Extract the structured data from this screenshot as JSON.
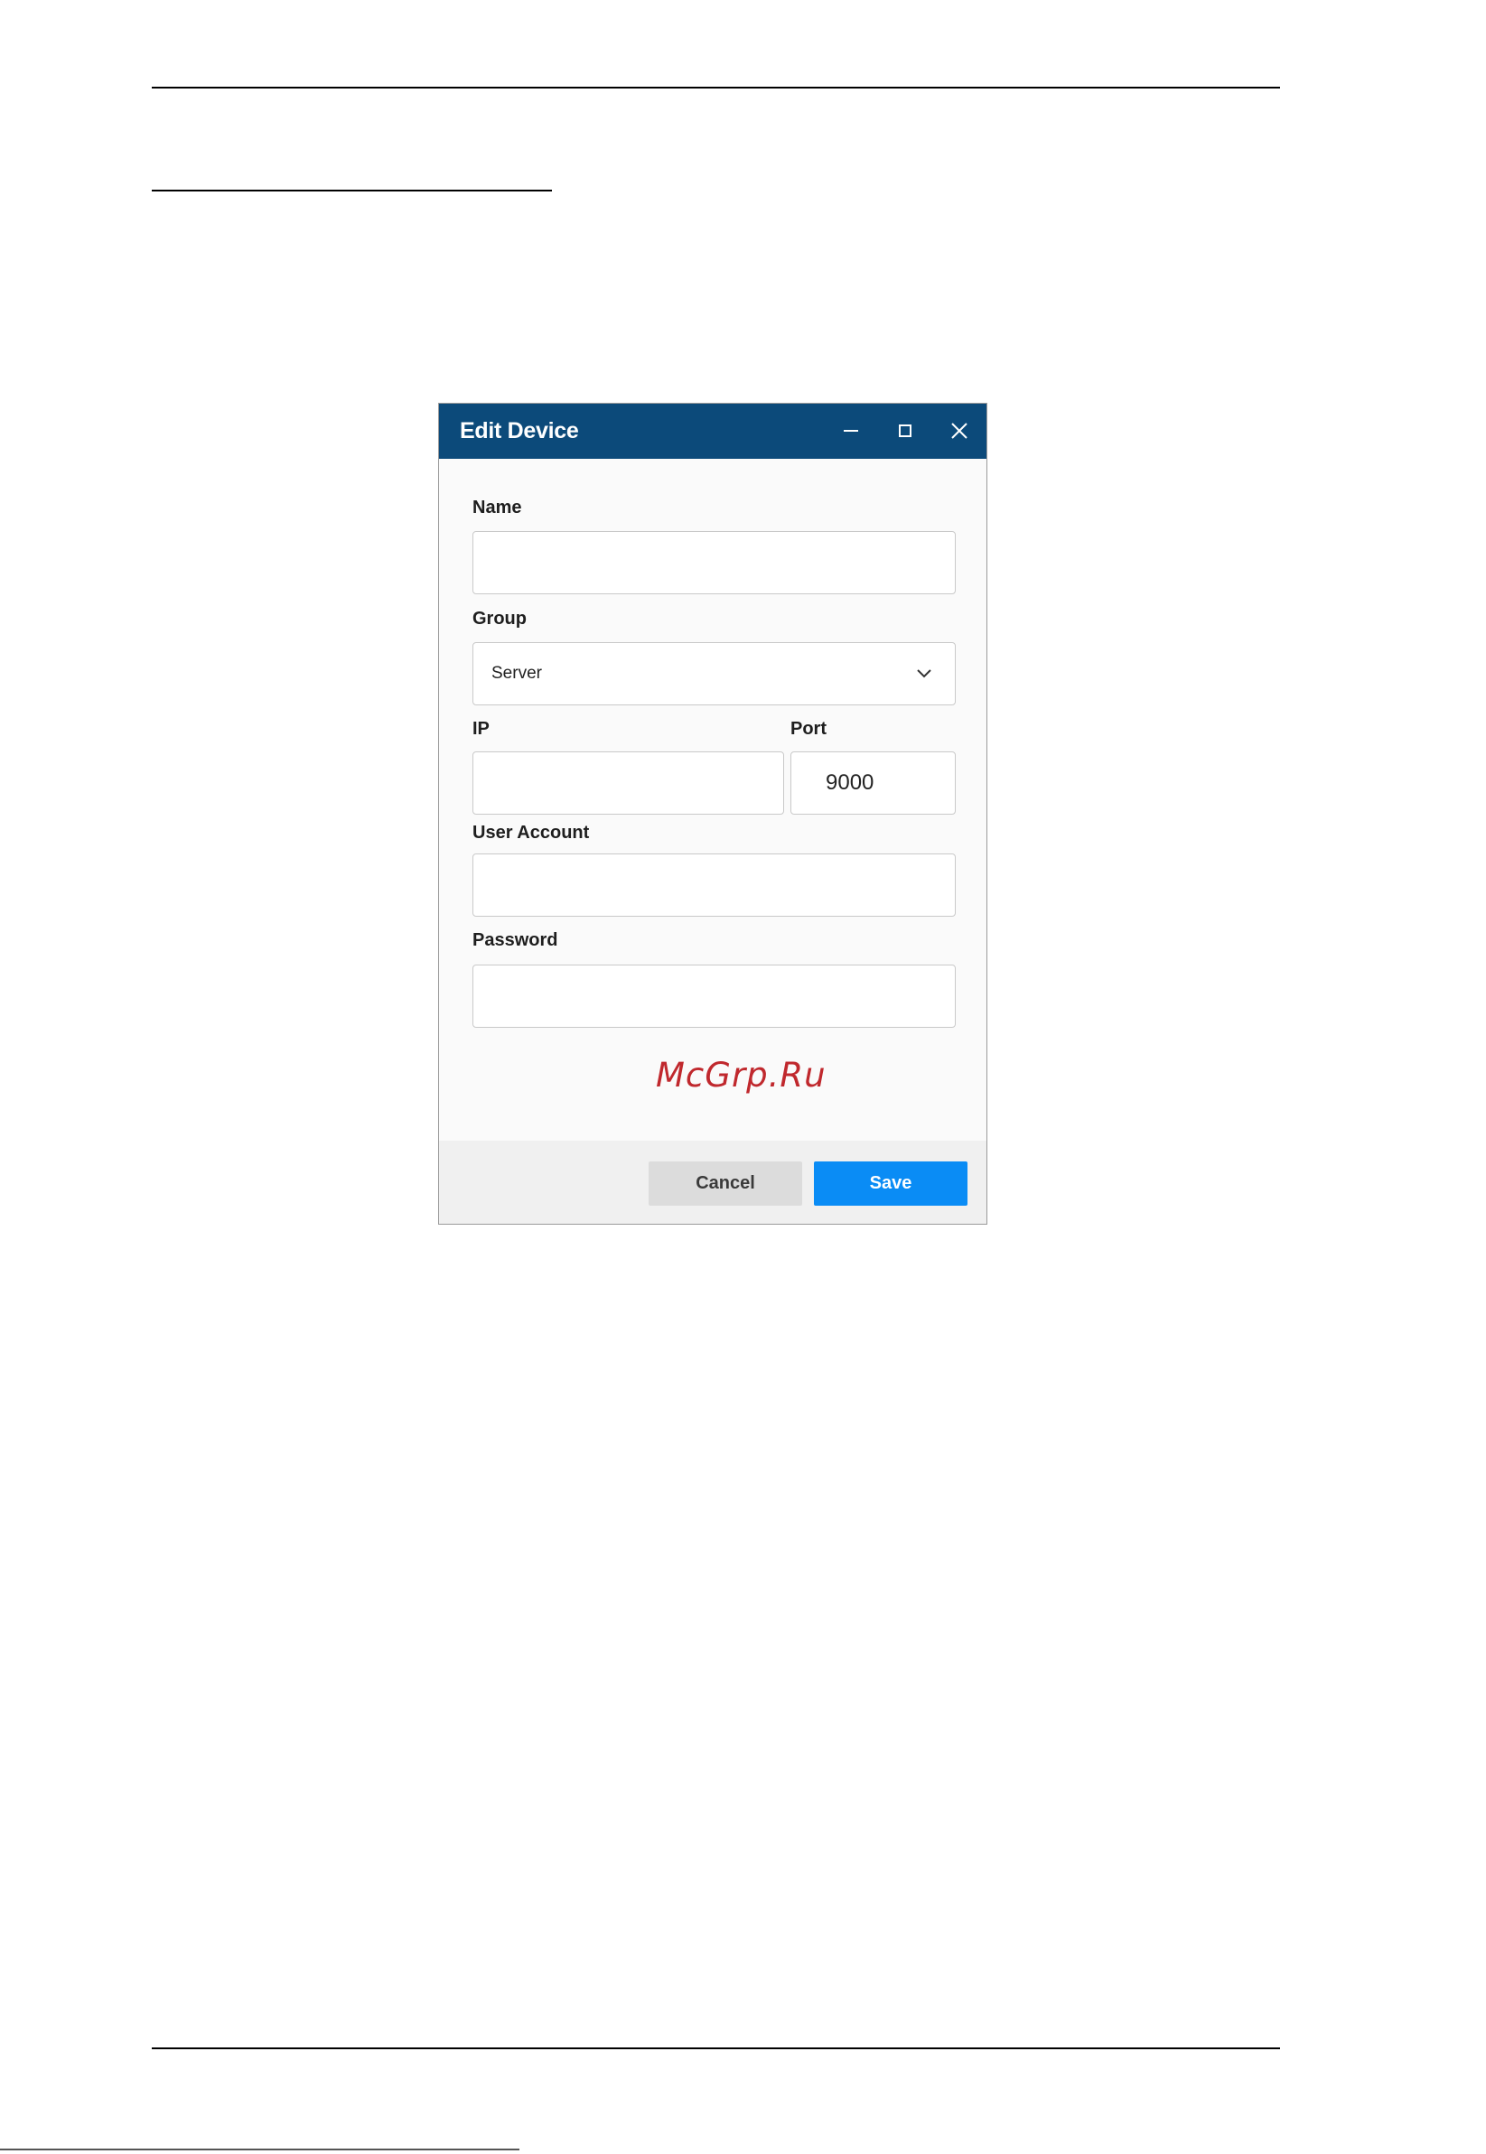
{
  "dialog": {
    "title": "Edit Device",
    "controls": {
      "minimize_icon": "minimize-icon",
      "maximize_icon": "maximize-icon",
      "close_icon": "close-icon"
    },
    "fields": {
      "name": {
        "label": "Name",
        "value": ""
      },
      "group": {
        "label": "Group",
        "value": "Server"
      },
      "ip": {
        "label": "IP",
        "value": ""
      },
      "port": {
        "label": "Port",
        "value": "9000"
      },
      "user_account": {
        "label": "User Account",
        "value": ""
      },
      "password": {
        "label": "Password",
        "value": ""
      }
    },
    "buttons": {
      "cancel": "Cancel",
      "save": "Save"
    }
  },
  "watermark": "McGrp.Ru",
  "colors": {
    "titlebar": "#0c4a7a",
    "save_button": "#0a8cf5",
    "cancel_button": "#dcdcdc",
    "watermark": "#c0282d"
  }
}
